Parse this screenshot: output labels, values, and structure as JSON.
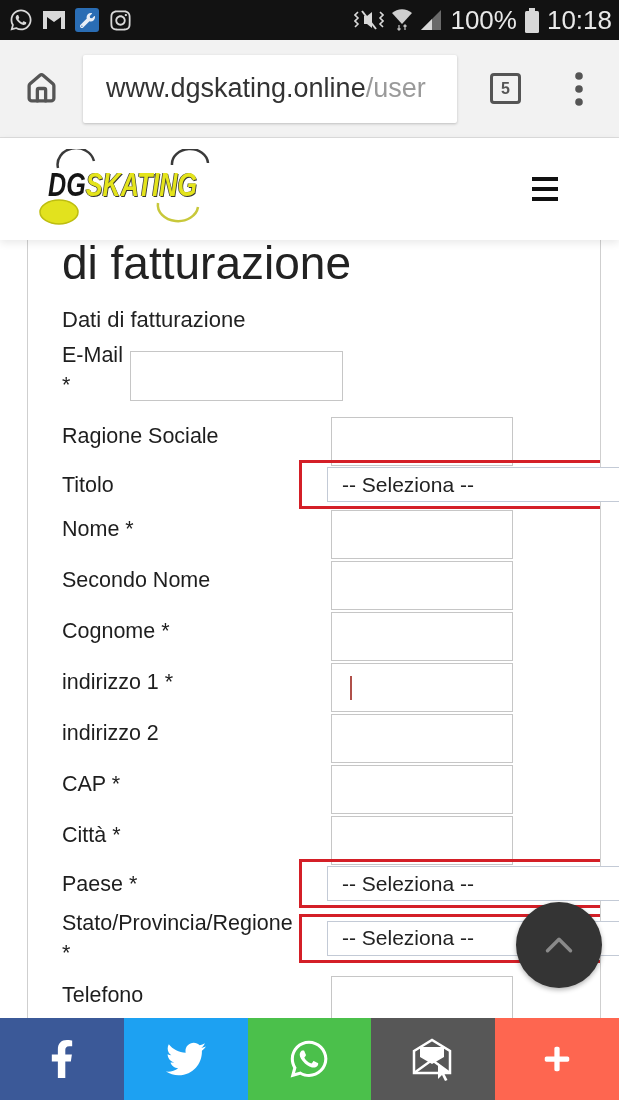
{
  "status_bar": {
    "battery": "100%",
    "time": "10:18"
  },
  "browser": {
    "url_host": "www.dgskating.online",
    "url_path": "/user",
    "tab_count": "5"
  },
  "site_header": {
    "logo": {
      "prefix": "DG",
      "name": "SKATING"
    }
  },
  "form": {
    "heading": "di fatturazione",
    "section": "Dati di fatturazione",
    "fields": [
      {
        "kind": "inline",
        "label": "E-Mail *",
        "focused": false,
        "highlighted": false
      },
      {
        "kind": "text",
        "label": "Ragione Sociale",
        "focused": false,
        "highlighted": false
      },
      {
        "kind": "select",
        "label": "Titolo",
        "value": "-- Seleziona --",
        "focused": false,
        "highlighted": true
      },
      {
        "kind": "text",
        "label": "Nome *",
        "focused": false,
        "highlighted": false
      },
      {
        "kind": "text",
        "label": "Secondo Nome",
        "focused": false,
        "highlighted": false
      },
      {
        "kind": "text",
        "label": "Cognome *",
        "focused": false,
        "highlighted": false
      },
      {
        "kind": "text",
        "label": "indirizzo 1 *",
        "focused": true,
        "highlighted": false
      },
      {
        "kind": "text",
        "label": "indirizzo 2",
        "focused": false,
        "highlighted": false
      },
      {
        "kind": "text",
        "label": "CAP *",
        "focused": false,
        "highlighted": false
      },
      {
        "kind": "text",
        "label": "Città *",
        "focused": false,
        "highlighted": false
      },
      {
        "kind": "select",
        "label": "Paese *",
        "value": "-- Seleziona --",
        "focused": false,
        "highlighted": true
      },
      {
        "kind": "select",
        "label": "Stato/Provincia/Regione *",
        "value": "-- Seleziona --",
        "focused": false,
        "highlighted": true
      },
      {
        "kind": "text",
        "label": "Telefono",
        "focused": false,
        "highlighted": false
      }
    ]
  },
  "share_bar": [
    {
      "color": "#3b5998"
    },
    {
      "color": "#1da1f2"
    },
    {
      "color": "#4bc04b"
    },
    {
      "color": "#575757"
    },
    {
      "color": "#fe6650"
    }
  ]
}
